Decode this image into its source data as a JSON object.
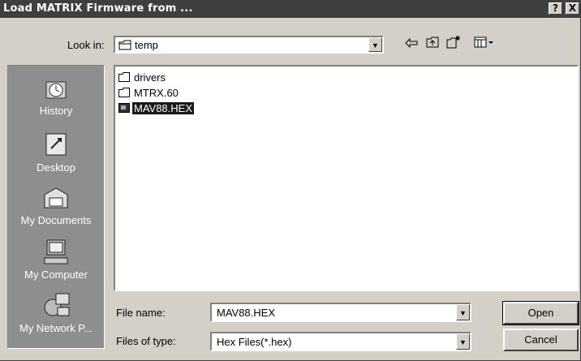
{
  "window": {
    "title": "Load MATRIX Firmware from ...",
    "help_label": "?",
    "close_label": "X"
  },
  "look_in": {
    "label": "Look in:",
    "value": "temp"
  },
  "toolbar": {
    "back_icon": "back-arrow-icon",
    "up_icon": "up-folder-icon",
    "new_folder_icon": "new-folder-icon",
    "views_icon": "views-menu-icon"
  },
  "places": [
    {
      "label": "History",
      "icon": "history-icon"
    },
    {
      "label": "Desktop",
      "icon": "desktop-icon"
    },
    {
      "label": "My Documents",
      "icon": "my-documents-icon"
    },
    {
      "label": "My Computer",
      "icon": "my-computer-icon"
    },
    {
      "label": "My Network P...",
      "icon": "my-network-icon"
    }
  ],
  "files": [
    {
      "name": "drivers",
      "type": "folder",
      "selected": false
    },
    {
      "name": "MTRX.60",
      "type": "folder",
      "selected": false
    },
    {
      "name": "MAV88.HEX",
      "type": "file",
      "selected": true
    }
  ],
  "file_name": {
    "label": "File name:",
    "value": "MAV88.HEX"
  },
  "file_type": {
    "label": "Files of type:",
    "value": "Hex Files(*.hex)"
  },
  "buttons": {
    "open": "Open",
    "cancel": "Cancel"
  }
}
